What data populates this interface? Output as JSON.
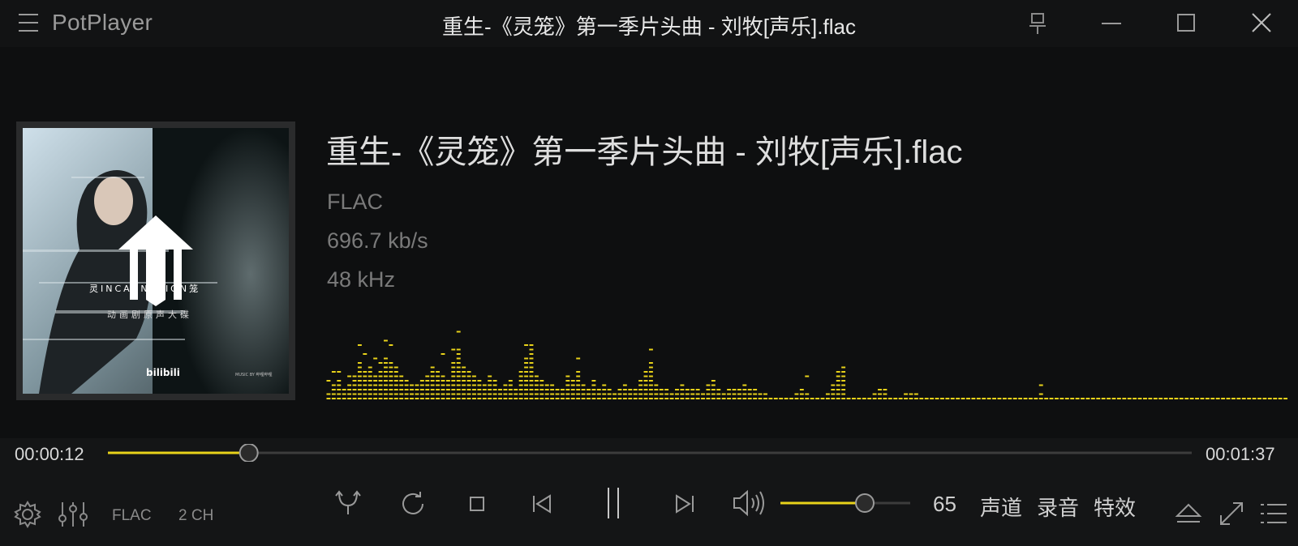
{
  "app": {
    "name": "PotPlayer",
    "window_title": "重生-《灵笼》第一季片头曲 - 刘牧[声乐].flac"
  },
  "track": {
    "title": "重生-《灵笼》第一季片头曲 - 刘牧[声乐].flac",
    "format": "FLAC",
    "bitrate": "696.7 kb/s",
    "sample_rate": "48 kHz"
  },
  "album_art": {
    "line_top": "灵INCARNATION笼",
    "line_bottom": "动画剧原声大碟",
    "logo": "bilibili",
    "credit": "MUSIC BY 哔哩哔哩"
  },
  "playback": {
    "current_time": "00:00:12",
    "total_time": "00:01:37",
    "progress": 0.13
  },
  "volume": {
    "value": "65",
    "level": 0.65
  },
  "status": {
    "codec": "FLAC",
    "channels": "2 CH"
  },
  "buttons": {
    "audio_channel": "声道",
    "record": "录音",
    "effects": "特效"
  },
  "colors": {
    "accent": "#e8d21a",
    "background": "#0e0f10"
  },
  "icons": [
    "menu-icon",
    "pin-icon",
    "minimize-icon",
    "maximize-icon",
    "close-icon",
    "settings-icon",
    "equalizer-icon",
    "shuffle-icon",
    "repeat-icon",
    "stop-icon",
    "previous-icon",
    "pause-icon",
    "next-icon",
    "volume-icon",
    "eject-icon",
    "fullscreen-icon",
    "playlist-icon"
  ],
  "spectrum": {
    "bars": [
      2,
      4,
      5,
      3,
      4,
      6,
      9,
      7,
      8,
      6,
      7,
      10,
      9,
      8,
      6,
      5,
      4,
      4,
      5,
      6,
      8,
      7,
      6,
      5,
      9,
      12,
      8,
      7,
      6,
      5,
      4,
      6,
      5,
      3,
      4,
      5,
      3,
      7,
      10,
      13,
      6,
      5,
      4,
      4,
      3,
      3,
      6,
      5,
      7,
      4,
      3,
      5,
      3,
      4,
      3,
      2,
      3,
      4,
      3,
      3,
      5,
      7,
      9,
      4,
      3,
      3,
      2,
      3,
      4,
      3,
      3,
      3,
      2,
      4,
      5,
      3,
      2,
      3,
      3,
      3,
      4,
      3,
      3,
      2,
      2,
      1,
      1,
      1,
      1,
      1,
      2,
      3,
      2,
      1,
      1,
      1,
      2,
      4,
      7,
      8,
      1,
      1,
      1,
      1,
      1,
      2,
      3,
      3,
      1,
      1,
      1,
      2,
      2,
      2,
      1,
      1,
      1,
      1,
      1,
      1,
      1,
      1,
      1,
      1,
      1,
      1,
      1,
      1,
      1,
      1,
      1,
      1,
      1,
      1,
      1,
      1,
      1,
      2,
      1,
      1,
      1,
      1,
      1,
      1,
      1,
      1,
      1,
      1,
      1,
      1,
      1,
      1,
      1,
      1,
      1,
      1,
      1,
      1,
      1,
      1,
      1,
      1,
      1,
      1,
      1,
      1,
      1,
      1,
      1,
      1,
      1,
      1,
      1,
      1,
      1,
      1,
      1,
      1,
      1,
      1,
      1,
      1,
      1,
      1,
      1
    ],
    "peaks": [
      4,
      6,
      6,
      0,
      5,
      0,
      12,
      10,
      0,
      9,
      8,
      13,
      12,
      0,
      0,
      0,
      0,
      0,
      0,
      0,
      0,
      0,
      10,
      0,
      11,
      15,
      0,
      0,
      0,
      0,
      0,
      0,
      0,
      0,
      0,
      0,
      0,
      0,
      12,
      16,
      0,
      0,
      0,
      0,
      0,
      0,
      0,
      0,
      9,
      0,
      0,
      0,
      0,
      0,
      0,
      0,
      0,
      0,
      0,
      0,
      0,
      0,
      11,
      0,
      0,
      0,
      0,
      0,
      0,
      0,
      0,
      0,
      0,
      0,
      0,
      0,
      0,
      0,
      0,
      0,
      0,
      0,
      0,
      0,
      0,
      0,
      0,
      0,
      0,
      0,
      0,
      0,
      5,
      0,
      0,
      0,
      0,
      0,
      0,
      0,
      0,
      0,
      0,
      0,
      0,
      0,
      0,
      0,
      0,
      0,
      0,
      0,
      0,
      0,
      0,
      0,
      0,
      0,
      0,
      0,
      0,
      0,
      0,
      0,
      0,
      0,
      0,
      0,
      0,
      0,
      0,
      0,
      0,
      0,
      0,
      0,
      0,
      3,
      0,
      0,
      0,
      0,
      0,
      0,
      0,
      0,
      0,
      0,
      0,
      0,
      0,
      0,
      0,
      0,
      0,
      0,
      0,
      0,
      0,
      0,
      0,
      0,
      0,
      0,
      0,
      0,
      0,
      0,
      0,
      0,
      0,
      0,
      0,
      0,
      0,
      0,
      0,
      0,
      0,
      0,
      0,
      0,
      0,
      0,
      0,
      0
    ]
  }
}
